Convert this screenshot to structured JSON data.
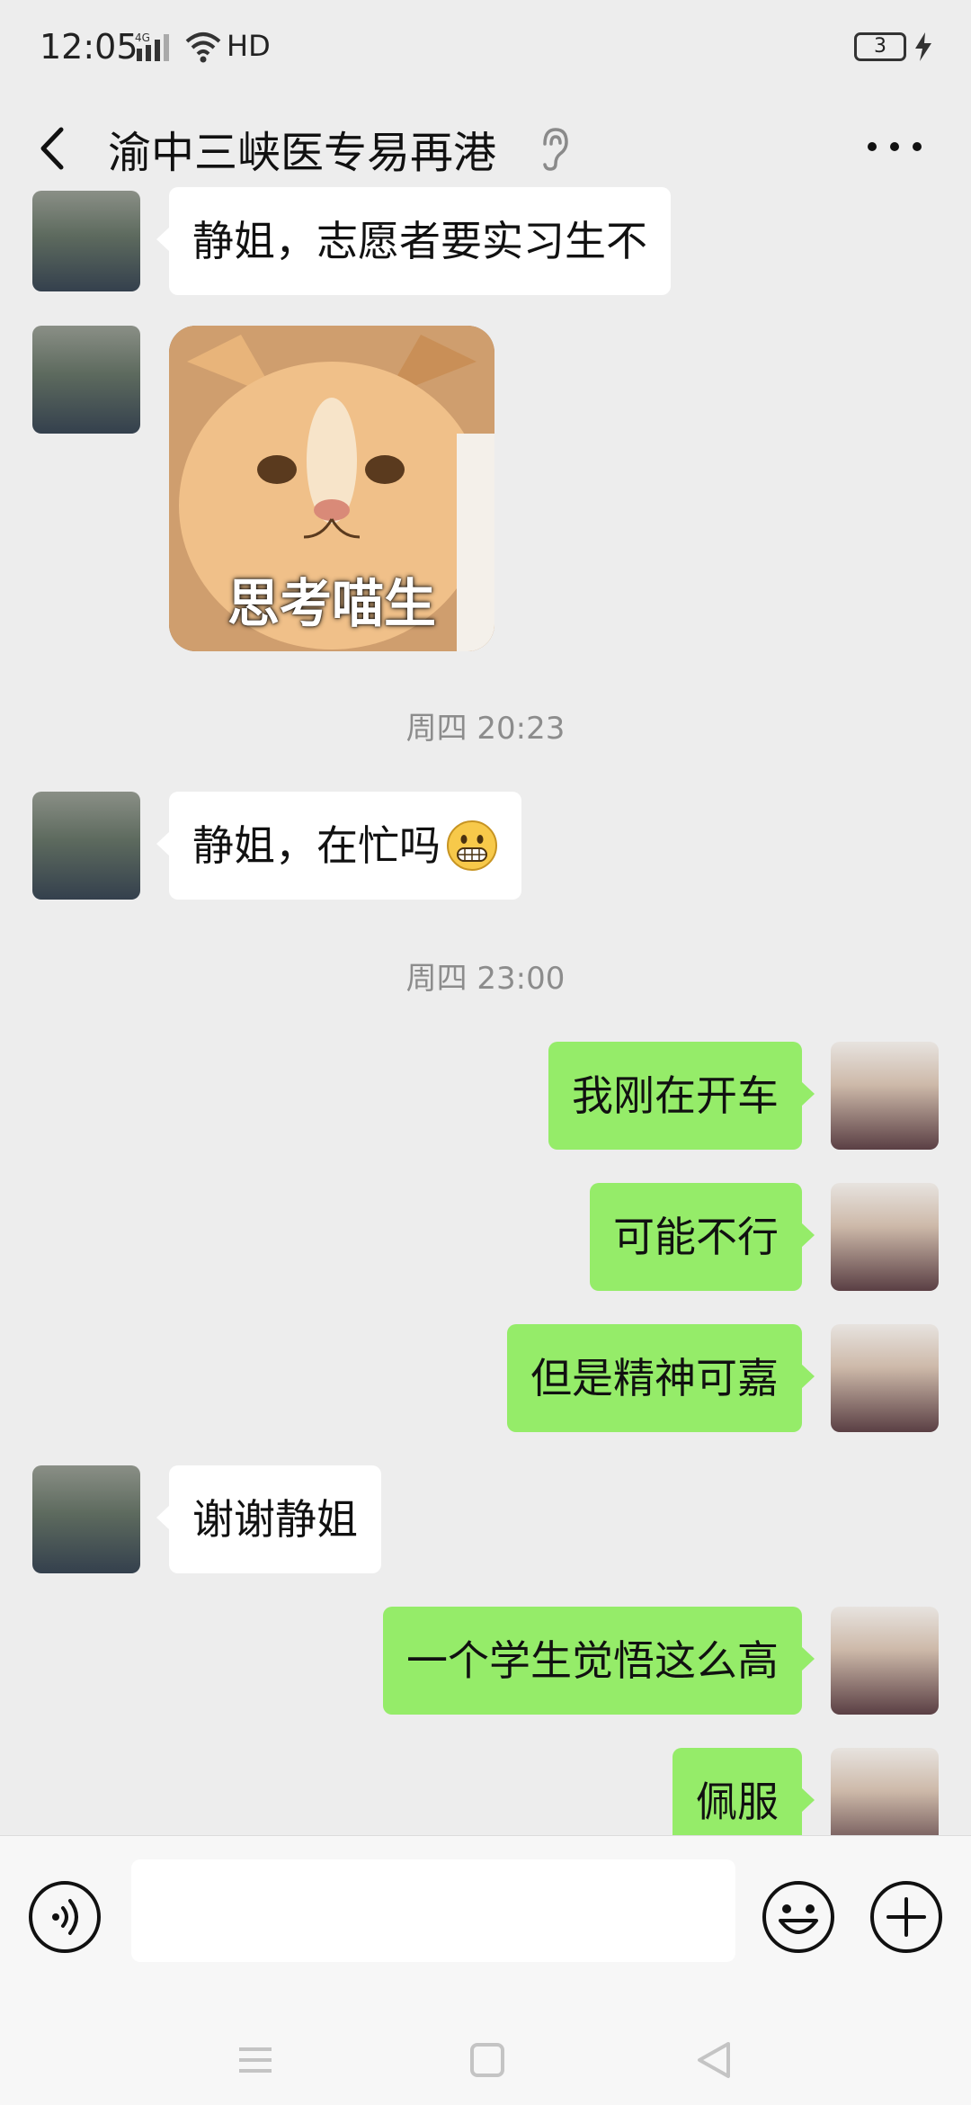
{
  "status_bar": {
    "time": "12:05",
    "network": "4G",
    "hd_label": "HD",
    "battery": "3",
    "icons": [
      "signal-icon",
      "wifi-icon",
      "battery-icon",
      "charging-icon"
    ]
  },
  "header": {
    "title": "渝中三峡医专易再港",
    "icons": [
      "back-arrow-icon",
      "earpiece-icon",
      "more-icon"
    ]
  },
  "messages": [
    {
      "side": "left",
      "type": "text",
      "text": "静姐，志愿者要实习生不"
    },
    {
      "side": "left",
      "type": "sticker",
      "caption": "思考喵生"
    },
    {
      "type": "timestamp",
      "text": "周四 20:23"
    },
    {
      "side": "left",
      "type": "text",
      "text": "静姐，在忙吗",
      "emoji": "grinning-face-icon"
    },
    {
      "type": "timestamp",
      "text": "周四 23:00"
    },
    {
      "side": "right",
      "type": "text",
      "text": "我刚在开车"
    },
    {
      "side": "right",
      "type": "text",
      "text": "可能不行"
    },
    {
      "side": "right",
      "type": "text",
      "text": "但是精神可嘉"
    },
    {
      "side": "left",
      "type": "text",
      "text": "谢谢静姐"
    },
    {
      "side": "right",
      "type": "text",
      "text": "一个学生觉悟这么高"
    },
    {
      "side": "right",
      "type": "text",
      "text": "佩服"
    }
  ],
  "input_bar": {
    "value": "",
    "icons": [
      "voice-icon",
      "emoji-icon",
      "plus-icon"
    ]
  },
  "nav_bar": {
    "icons": [
      "menu-icon",
      "home-icon",
      "back-triangle-icon"
    ]
  },
  "colors": {
    "background": "#ededed",
    "bubble_self": "#95ec69",
    "bubble_other": "#ffffff",
    "timestamp": "#8c8c8c"
  }
}
